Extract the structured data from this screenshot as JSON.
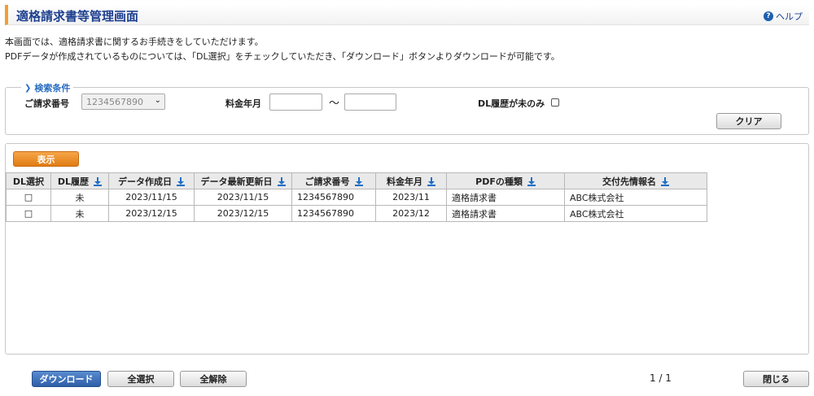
{
  "header": {
    "title": "適格請求書等管理画面",
    "help_label": "ヘルプ",
    "help_icon": "question-icon"
  },
  "description": {
    "line1": "本画面では、適格請求書に関するお手続きをしていただけます。",
    "line2": "PDFデータが作成されているものについては、「DL選択」をチェックしていただき、「ダウンロード」ボタンよりダウンロードが可能です。"
  },
  "search": {
    "legend": "検索条件",
    "invoice_no_label": "ご請求番号",
    "invoice_no_value": "1234567890",
    "billing_month_label": "料金年月",
    "billing_from": "",
    "billing_to": "",
    "range_sep": "〜",
    "dl_unhistory_label": "DL履歴が未のみ",
    "dl_unhistory_checked": false,
    "clear_label": "クリア"
  },
  "results": {
    "show_label": "表示",
    "columns": [
      "DL選択",
      "DL履歴",
      "データ作成日",
      "データ最新更新日",
      "ご請求番号",
      "料金年月",
      "PDFの種類",
      "交付先情報名"
    ],
    "rows": [
      {
        "dl_select": "□",
        "dl_history": "未",
        "created": "2023/11/15",
        "updated": "2023/11/15",
        "invoice_no": "1234567890",
        "month": "2023/11",
        "pdf_type": "適格請求書",
        "recipient": "ABC株式会社"
      },
      {
        "dl_select": "□",
        "dl_history": "未",
        "created": "2023/12/15",
        "updated": "2023/12/15",
        "invoice_no": "1234567890",
        "month": "2023/12",
        "pdf_type": "適格請求書",
        "recipient": "ABC株式会社"
      }
    ]
  },
  "footer": {
    "download_label": "ダウンロード",
    "select_all_label": "全選択",
    "deselect_all_label": "全解除",
    "page_indicator": "1 / 1",
    "close_label": "閉じる"
  },
  "colors": {
    "title": "#1d3f8f",
    "accent_orange": "#e07b12",
    "download_blue": "#2e5fa8",
    "legend_blue": "#2a6cc0"
  }
}
